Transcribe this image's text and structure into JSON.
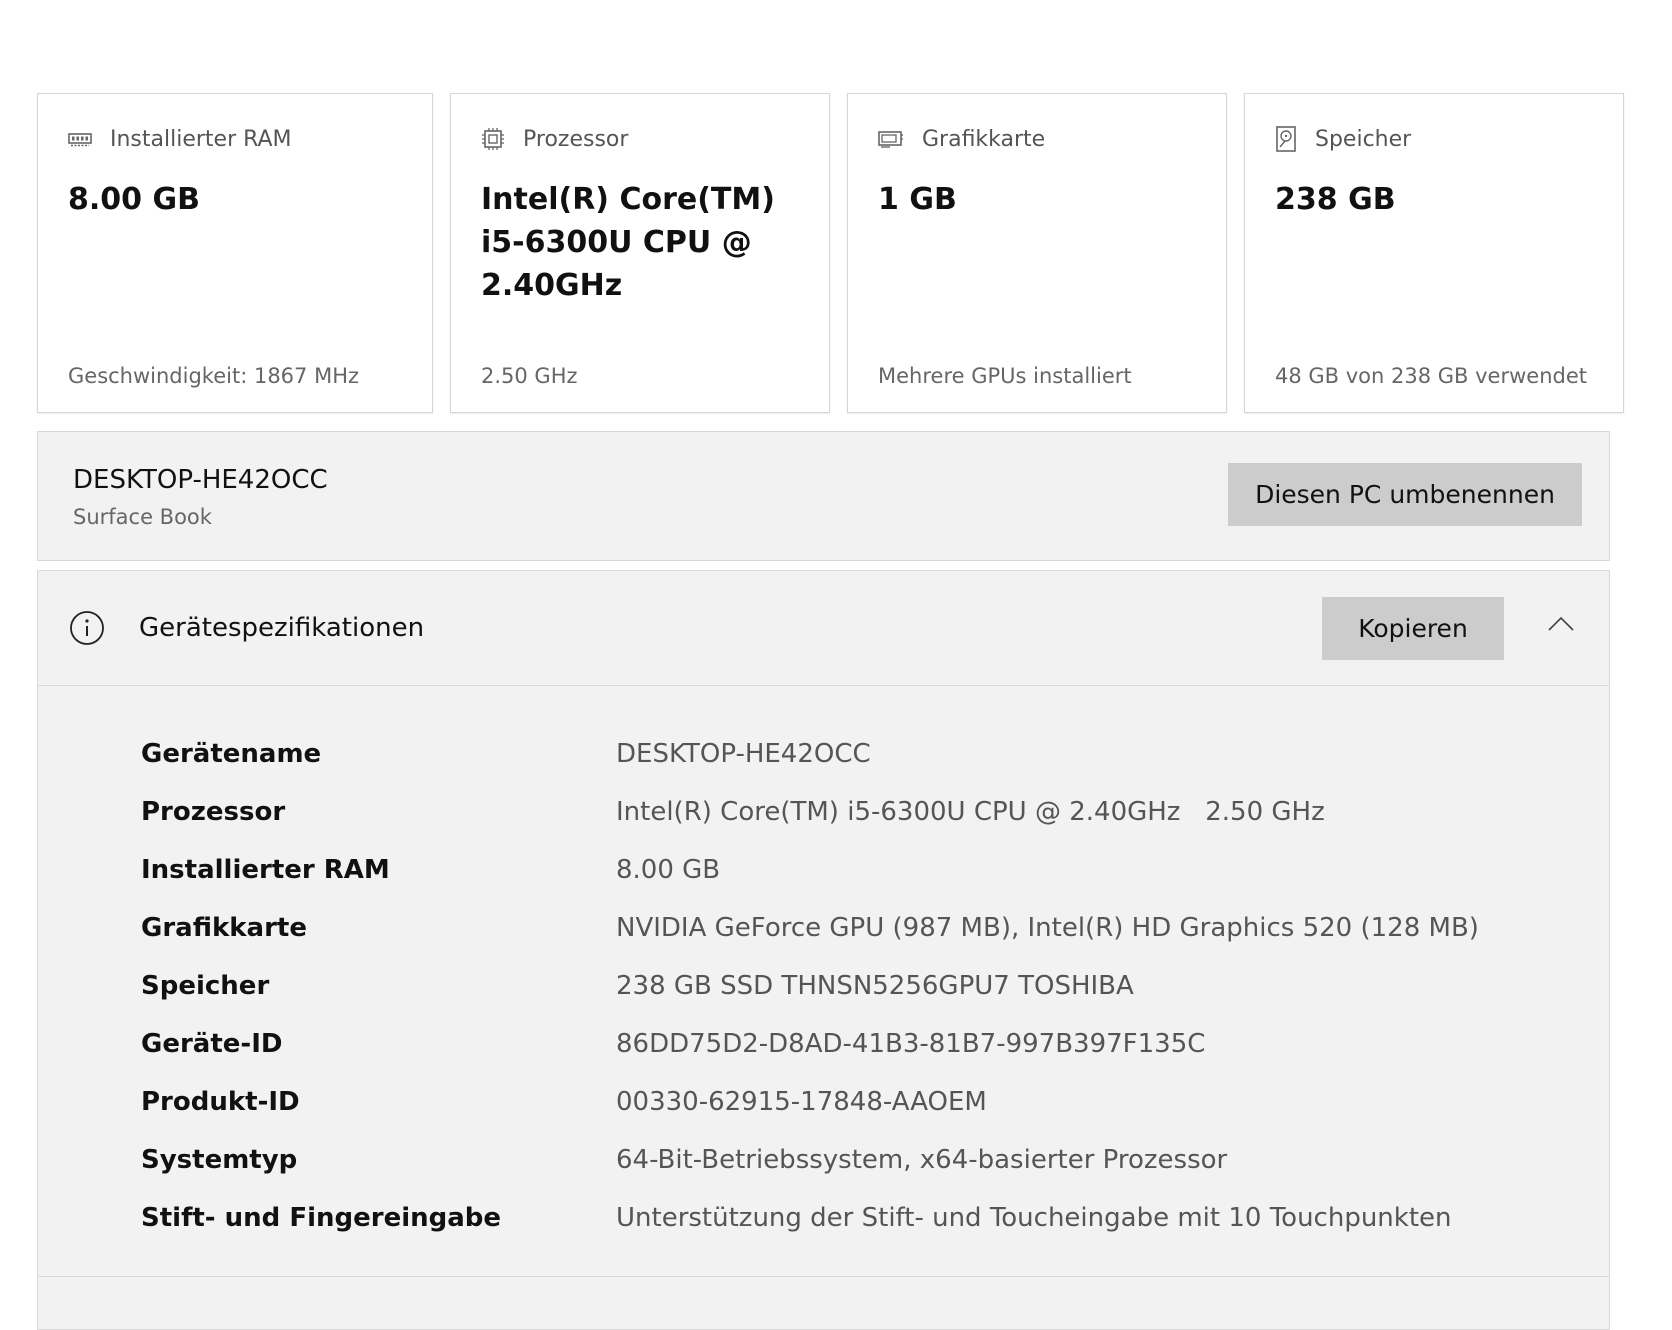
{
  "cards": [
    {
      "icon": "ram-icon",
      "label": "Installierter RAM",
      "value": "8.00 GB",
      "footer": "Geschwindigkeit: 1867 MHz"
    },
    {
      "icon": "processor-icon",
      "label": "Prozessor",
      "value": "Intel(R) Core(TM) i5-6300U CPU @ 2.40GHz",
      "footer": "2.50 GHz"
    },
    {
      "icon": "graphics-card-icon",
      "label": "Grafikkarte",
      "value": "1 GB",
      "footer": "Mehrere GPUs installiert"
    },
    {
      "icon": "storage-icon",
      "label": "Speicher",
      "value": "238 GB",
      "footer": "48 GB von 238 GB verwendet"
    }
  ],
  "pc": {
    "name": "DESKTOP-HE42OCC",
    "model": "Surface Book",
    "rename_label": "Diesen PC umbenennen"
  },
  "specs": {
    "title": "Gerätespezifikationen",
    "copy_label": "Kopieren",
    "rows": [
      {
        "label": "Gerätename",
        "value": "DESKTOP-HE42OCC"
      },
      {
        "label": "Prozessor",
        "value": "Intel(R) Core(TM) i5-6300U CPU @ 2.40GHz   2.50 GHz"
      },
      {
        "label": "Installierter RAM",
        "value": "8.00 GB"
      },
      {
        "label": "Grafikkarte",
        "value": "NVIDIA GeForce GPU (987 MB), Intel(R) HD Graphics 520 (128 MB)"
      },
      {
        "label": "Speicher",
        "value": "238 GB SSD THNSN5256GPU7 TOSHIBA"
      },
      {
        "label": "Geräte-ID",
        "value": "86DD75D2-D8AD-41B3-81B7-997B397F135C"
      },
      {
        "label": "Produkt-ID",
        "value": "00330-62915-17848-AAOEM"
      },
      {
        "label": "Systemtyp",
        "value": "64-Bit-Betriebssystem, x64-basierter Prozessor"
      },
      {
        "label": "Stift- und Fingereingabe",
        "value": "Unterstützung der Stift- und Toucheingabe mit 10 Touchpunkten"
      }
    ]
  }
}
